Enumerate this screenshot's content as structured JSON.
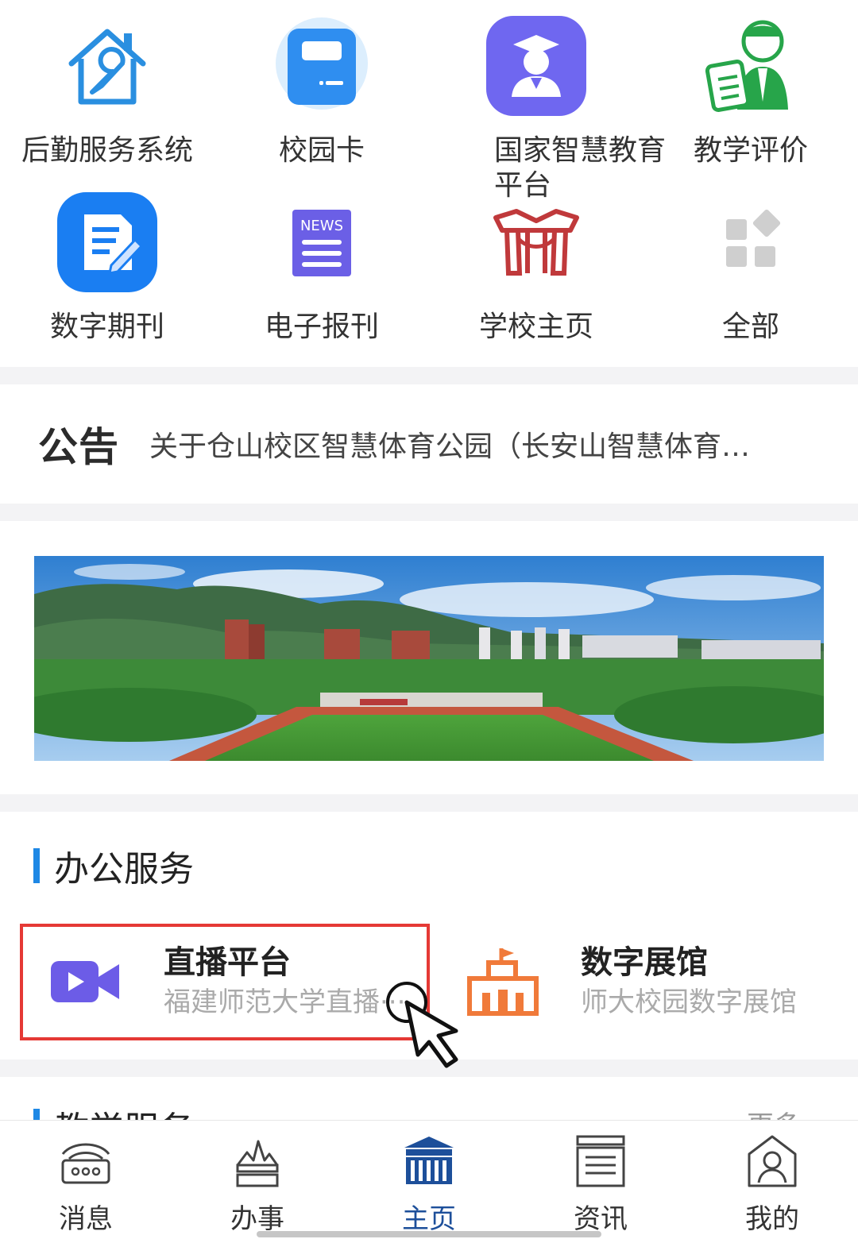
{
  "apps_row1": [
    {
      "label": "后勤服务系统",
      "icon": "house-wrench-icon"
    },
    {
      "label": "校园卡",
      "icon": "card-icon"
    },
    {
      "label": "国家智慧教育平台",
      "icon": "graduate-icon"
    },
    {
      "label": "教学评价",
      "icon": "teacher-clipboard-icon"
    }
  ],
  "apps_row2": [
    {
      "label": "数字期刊",
      "icon": "document-edit-icon"
    },
    {
      "label": "电子报刊",
      "icon": "news-icon"
    },
    {
      "label": "学校主页",
      "icon": "school-gate-icon"
    },
    {
      "label": "全部",
      "icon": "grid-icon"
    }
  ],
  "notice": {
    "tag": "公告",
    "text": "关于仓山校区智慧体育公园（长安山智慧体育…"
  },
  "banner": {
    "icon": "campus-photo"
  },
  "office_section": {
    "title": "办公服务"
  },
  "services": [
    {
      "name": "直播平台",
      "desc": "福建师范大学直播···",
      "icon": "video-camera-icon"
    },
    {
      "name": "数字展馆",
      "desc": "师大校园数字展馆",
      "icon": "museum-icon"
    }
  ],
  "teaching_section": {
    "title": "教学服务",
    "more": "更多"
  },
  "tabs": [
    {
      "label": "消息",
      "icon": "message-icon",
      "active": false
    },
    {
      "label": "办事",
      "icon": "tasks-icon",
      "active": false
    },
    {
      "label": "主页",
      "icon": "home-building-icon",
      "active": true
    },
    {
      "label": "资讯",
      "icon": "news-list-icon",
      "active": false
    },
    {
      "label": "我的",
      "icon": "profile-icon",
      "active": false
    }
  ],
  "colors": {
    "accent_blue": "#1e88e5",
    "active_tab": "#1d4f9a",
    "highlight_red": "#e53935",
    "video_purple": "#6c5ce7",
    "museum_orange": "#f07a3a"
  }
}
